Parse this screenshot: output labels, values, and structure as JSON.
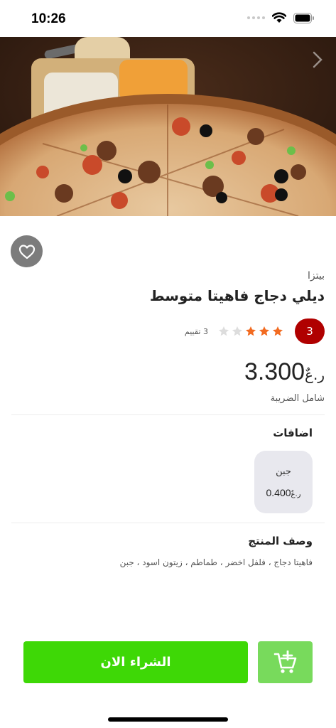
{
  "status_bar": {
    "time": "10:26"
  },
  "product": {
    "category": "بيتزا",
    "name": "ديلي دجاج فاهيتا متوسط",
    "rating_badge": "3",
    "rating_value": 3,
    "rating_max": 5,
    "rating_count_text": "3 تقييم",
    "price": "3.300",
    "currency": "ر.عٌ",
    "tax_note": "شامل الضريبة"
  },
  "addons": {
    "title": "اضافات",
    "items": [
      {
        "name": "جبن",
        "price": "0.400",
        "currency": "ر.عٌ"
      }
    ]
  },
  "description": {
    "title": "وصف المنتج",
    "text": "فاهيتا دجاج ، فلفل اخضر ، طماطم ، زيتون اسود ، جبن"
  },
  "actions": {
    "buy_label": "الشراء الان"
  },
  "colors": {
    "star_active": "#f26b21",
    "star_inactive": "#dddddd",
    "rating_badge": "#b00000",
    "buy_button": "#3ed806",
    "cart_button": "#78da5c",
    "favorite_button": "#7c7c7c"
  },
  "icons": {
    "wifi": "wifi-icon",
    "battery": "battery-icon",
    "favorite": "heart-icon",
    "cart": "cart-plus-icon",
    "next": "chevron-right-icon"
  }
}
